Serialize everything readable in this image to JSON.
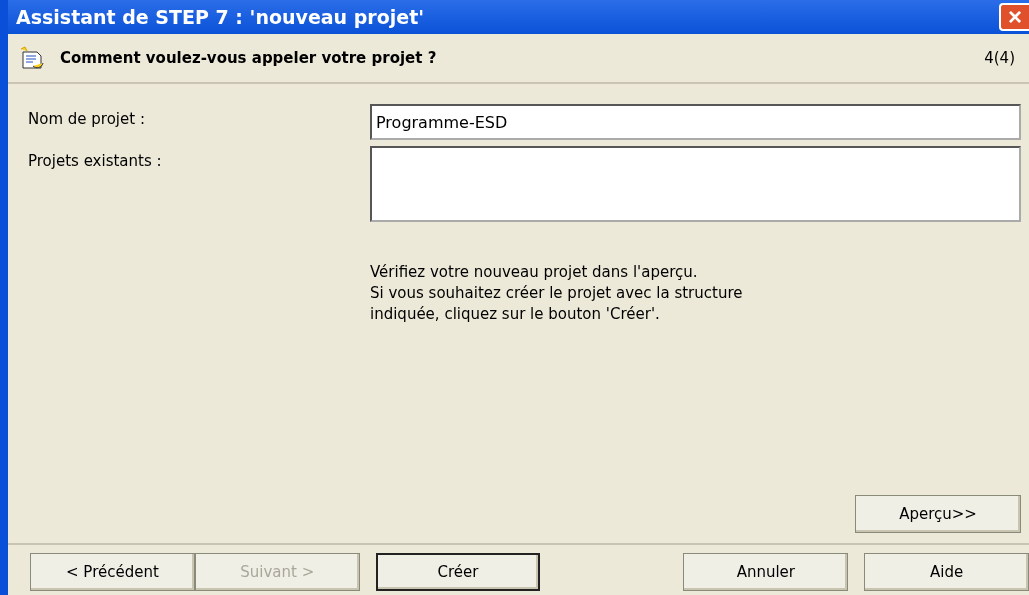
{
  "window": {
    "title": "Assistant de STEP 7 : 'nouveau projet'",
    "close": "×"
  },
  "header": {
    "question": "Comment voulez-vous appeler votre projet ?",
    "step": "4(4)"
  },
  "form": {
    "name_label": "Nom de projet :",
    "name_value": "Programme-ESD",
    "existing_label": "Projets existants :"
  },
  "info": [
    "Vérifiez votre nouveau projet dans l'aperçu.",
    "Si vous souhaitez créer le projet avec la structure",
    "indiquée, cliquez sur le bouton 'Créer'."
  ],
  "preview_button": {
    "label": "Aperçu>>",
    "disabled": false
  },
  "buttons": [
    {
      "label": "< Précédent",
      "disabled": false,
      "default": false
    },
    {
      "label": "Suivant >",
      "disabled": true,
      "default": false
    },
    {
      "label": "Créer",
      "disabled": false,
      "default": true
    },
    {
      "label": "Annuler",
      "disabled": false,
      "default": false
    },
    {
      "label": "Aide",
      "disabled": false,
      "default": false
    }
  ]
}
